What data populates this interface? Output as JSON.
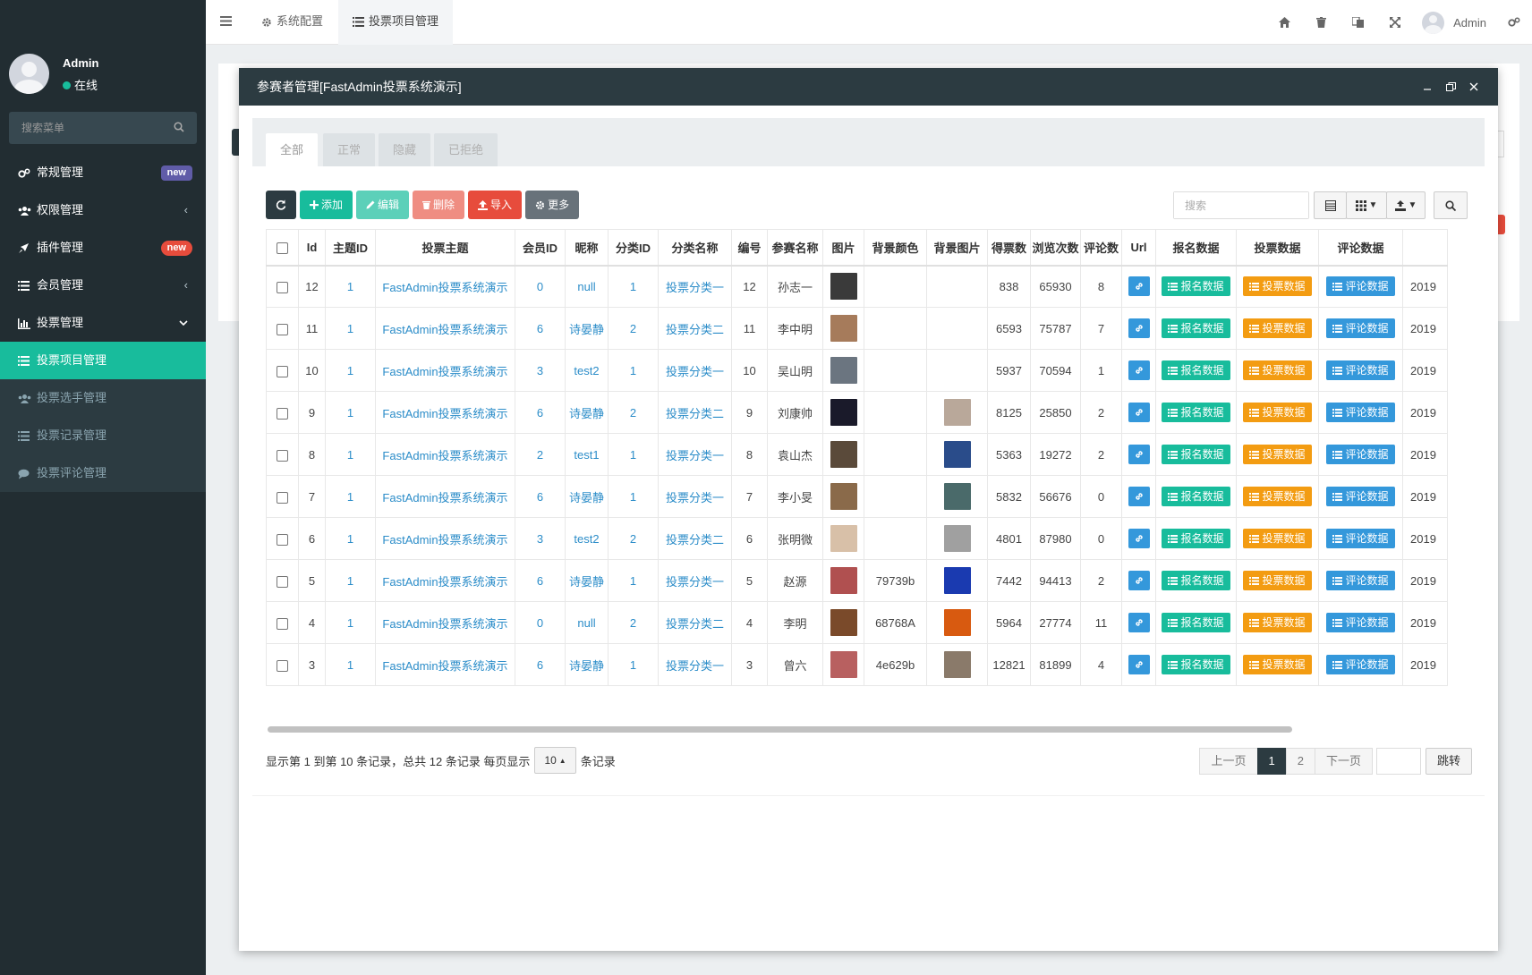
{
  "sidebar": {
    "user_name": "Admin",
    "status": "在线",
    "search_placeholder": "搜索菜单",
    "items": [
      {
        "label": "常规管理",
        "badge": "new",
        "badge_color": "#605ca8"
      },
      {
        "label": "权限管理"
      },
      {
        "label": "插件管理",
        "badge": "new",
        "badge_color": "#e74c3c"
      },
      {
        "label": "会员管理"
      },
      {
        "label": "投票管理"
      }
    ],
    "subitems": [
      {
        "label": "投票项目管理"
      },
      {
        "label": "投票选手管理"
      },
      {
        "label": "投票记录管理"
      },
      {
        "label": "投票评论管理"
      }
    ]
  },
  "topnav": {
    "tabs": [
      {
        "label": "系统配置"
      },
      {
        "label": "投票项目管理"
      }
    ],
    "user_name": "Admin"
  },
  "modal": {
    "title": "参赛者管理[FastAdmin投票系统演示]",
    "tabs": [
      "全部",
      "正常",
      "隐藏",
      "已拒绝"
    ],
    "toolbar": {
      "add": "添加",
      "edit": "编辑",
      "delete": "删除",
      "import": "导入",
      "more": "更多"
    },
    "search_placeholder": "搜索",
    "columns": [
      "Id",
      "主题ID",
      "投票主题",
      "会员ID",
      "昵称",
      "分类ID",
      "分类名称",
      "编号",
      "参赛名称",
      "图片",
      "背景颜色",
      "背景图片",
      "得票数",
      "浏览次数",
      "评论数",
      "Url",
      "报名数据",
      "投票数据",
      "评论数据"
    ],
    "action_labels": {
      "signup": "报名数据",
      "vote": "投票数据",
      "comment": "评论数据"
    },
    "last_col_text": "2019",
    "rows": [
      {
        "id": "12",
        "subject_id": "1",
        "subject": "FastAdmin投票系统演示",
        "user_id": "0",
        "nickname": "null",
        "cat_id": "1",
        "cat_name": "投票分类一",
        "number": "12",
        "name": "孙志一",
        "img_color": "#3a3a3a",
        "bg_color": "",
        "bg_img_color": "",
        "votes": "838",
        "views": "65930",
        "comments": "8"
      },
      {
        "id": "11",
        "subject_id": "1",
        "subject": "FastAdmin投票系统演示",
        "user_id": "6",
        "nickname": "诗晏静",
        "cat_id": "2",
        "cat_name": "投票分类二",
        "number": "11",
        "name": "李中明",
        "img_color": "#a67b5b",
        "bg_color": "",
        "bg_img_color": "",
        "votes": "6593",
        "views": "75787",
        "comments": "7"
      },
      {
        "id": "10",
        "subject_id": "1",
        "subject": "FastAdmin投票系统演示",
        "user_id": "3",
        "nickname": "test2",
        "cat_id": "1",
        "cat_name": "投票分类一",
        "number": "10",
        "name": "吴山明",
        "img_color": "#6b7580",
        "bg_color": "",
        "bg_img_color": "",
        "votes": "5937",
        "views": "70594",
        "comments": "1"
      },
      {
        "id": "9",
        "subject_id": "1",
        "subject": "FastAdmin投票系统演示",
        "user_id": "6",
        "nickname": "诗晏静",
        "cat_id": "2",
        "cat_name": "投票分类二",
        "number": "9",
        "name": "刘康帅",
        "img_color": "#1a1a2a",
        "bg_color": "",
        "bg_img_color": "#b9a89a",
        "votes": "8125",
        "views": "25850",
        "comments": "2"
      },
      {
        "id": "8",
        "subject_id": "1",
        "subject": "FastAdmin投票系统演示",
        "user_id": "2",
        "nickname": "test1",
        "cat_id": "1",
        "cat_name": "投票分类一",
        "number": "8",
        "name": "袁山杰",
        "img_color": "#5a4a3a",
        "bg_color": "",
        "bg_img_color": "#2a4c8a",
        "votes": "5363",
        "views": "19272",
        "comments": "2"
      },
      {
        "id": "7",
        "subject_id": "1",
        "subject": "FastAdmin投票系统演示",
        "user_id": "6",
        "nickname": "诗晏静",
        "cat_id": "1",
        "cat_name": "投票分类一",
        "number": "7",
        "name": "李小旻",
        "img_color": "#8a6a4a",
        "bg_color": "",
        "bg_img_color": "#4a6a6a",
        "votes": "5832",
        "views": "56676",
        "comments": "0"
      },
      {
        "id": "6",
        "subject_id": "1",
        "subject": "FastAdmin投票系统演示",
        "user_id": "3",
        "nickname": "test2",
        "cat_id": "2",
        "cat_name": "投票分类二",
        "number": "6",
        "name": "张明微",
        "img_color": "#d8c0a8",
        "bg_color": "",
        "bg_img_color": "#a0a0a0",
        "votes": "4801",
        "views": "87980",
        "comments": "0"
      },
      {
        "id": "5",
        "subject_id": "1",
        "subject": "FastAdmin投票系统演示",
        "user_id": "6",
        "nickname": "诗晏静",
        "cat_id": "1",
        "cat_name": "投票分类一",
        "number": "5",
        "name": "赵源",
        "img_color": "#b05050",
        "bg_color": "79739b",
        "bg_img_color": "#1a3ab0",
        "votes": "7442",
        "views": "94413",
        "comments": "2"
      },
      {
        "id": "4",
        "subject_id": "1",
        "subject": "FastAdmin投票系统演示",
        "user_id": "0",
        "nickname": "null",
        "cat_id": "2",
        "cat_name": "投票分类二",
        "number": "4",
        "name": "李明",
        "img_color": "#7a4a2a",
        "bg_color": "68768A",
        "bg_img_color": "#d85a10",
        "votes": "5964",
        "views": "27774",
        "comments": "11"
      },
      {
        "id": "3",
        "subject_id": "1",
        "subject": "FastAdmin投票系统演示",
        "user_id": "6",
        "nickname": "诗晏静",
        "cat_id": "1",
        "cat_name": "投票分类一",
        "number": "3",
        "name": "曾六",
        "img_color": "#b86060",
        "bg_color": "4e629b",
        "bg_img_color": "#8a7a6a",
        "votes": "12821",
        "views": "81899",
        "comments": "4"
      }
    ],
    "pager": {
      "info": "显示第 1 到第 10 条记录，总共 12 条记录 每页显示",
      "page_size": "10",
      "suffix": "条记录",
      "prev": "上一页",
      "pages": [
        "1",
        "2"
      ],
      "next": "下一页",
      "go": "跳转"
    }
  }
}
